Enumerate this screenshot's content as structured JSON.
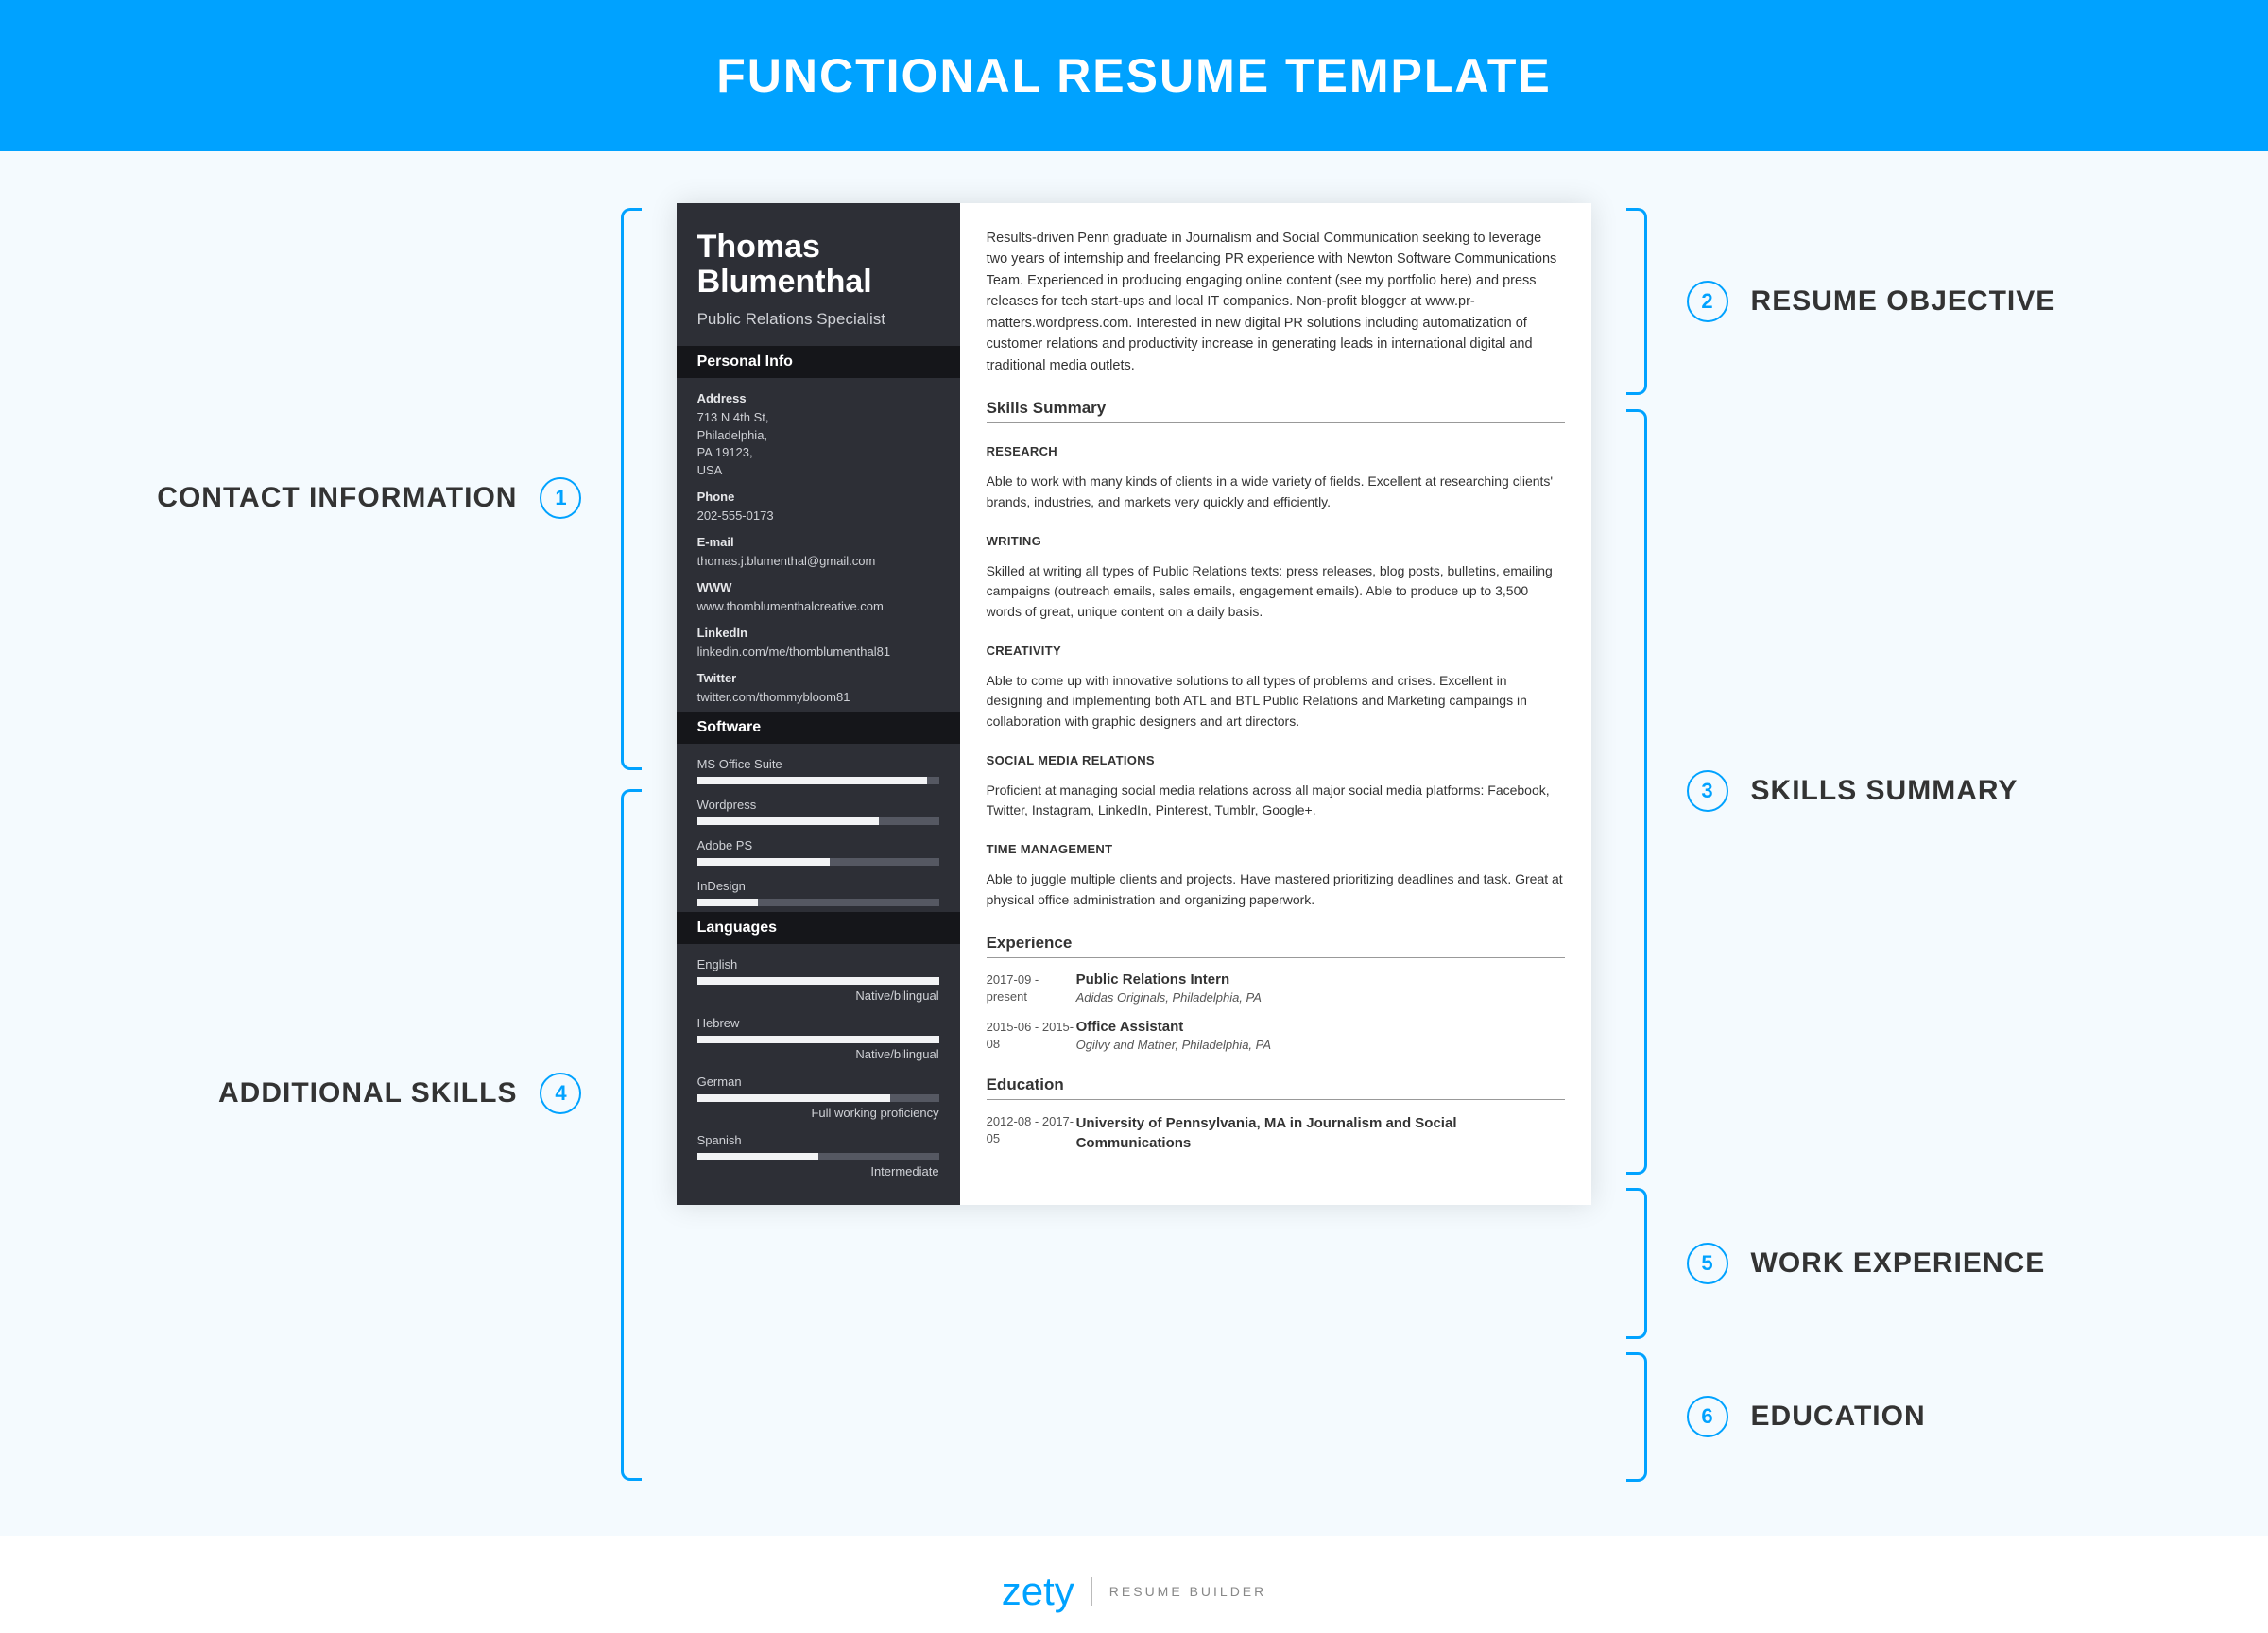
{
  "header": {
    "title": "FUNCTIONAL RESUME TEMPLATE"
  },
  "callouts": {
    "left": [
      {
        "num": "1",
        "text": "CONTACT INFORMATION"
      },
      {
        "num": "4",
        "text": "ADDITIONAL SKILLS"
      }
    ],
    "right": [
      {
        "num": "2",
        "text": "RESUME OBJECTIVE"
      },
      {
        "num": "3",
        "text": "SKILLS SUMMARY"
      },
      {
        "num": "5",
        "text": "WORK EXPERIENCE"
      },
      {
        "num": "6",
        "text": "EDUCATION"
      }
    ]
  },
  "resume": {
    "name_first": "Thomas",
    "name_last": "Blumenthal",
    "jobtitle": "Public Relations Specialist",
    "contact_header": "Personal Info",
    "contact": [
      {
        "label": "Address",
        "value": "713 N 4th St,\nPhiladelphia,\nPA 19123,\nUSA"
      },
      {
        "label": "Phone",
        "value": "202-555-0173"
      },
      {
        "label": "E-mail",
        "value": "thomas.j.blumenthal@gmail.com"
      },
      {
        "label": "WWW",
        "value": "www.thomblumenthalcreative.com"
      },
      {
        "label": "LinkedIn",
        "value": "linkedin.com/me/thomblumenthal81"
      },
      {
        "label": "Twitter",
        "value": "twitter.com/thommybloom81"
      }
    ],
    "software_header": "Software",
    "software": [
      {
        "name": "MS Office Suite",
        "pct": 95
      },
      {
        "name": "Wordpress",
        "pct": 75
      },
      {
        "name": "Adobe PS",
        "pct": 55
      },
      {
        "name": "InDesign",
        "pct": 25
      }
    ],
    "languages_header": "Languages",
    "languages": [
      {
        "name": "English",
        "pct": 100,
        "level": "Native/bilingual"
      },
      {
        "name": "Hebrew",
        "pct": 100,
        "level": "Native/bilingual"
      },
      {
        "name": "German",
        "pct": 80,
        "level": "Full working proficiency"
      },
      {
        "name": "Spanish",
        "pct": 50,
        "level": "Intermediate"
      }
    ],
    "objective": "Results-driven Penn graduate in Journalism and Social Communication seeking to leverage two years of internship and freelancing PR experience with Newton Software Communications Team. Experienced in producing engaging online content (see my portfolio here) and press releases for tech start-ups and local IT companies. Non-profit blogger at www.pr-matters.wordpress.com. Interested in new digital PR solutions including automatization of customer relations and productivity increase in generating leads in international digital and traditional media outlets.",
    "skills_summary_title": "Skills Summary",
    "skills": [
      {
        "title": "RESEARCH",
        "body": "Able to work with many kinds of clients in a wide variety of fields. Excellent at researching clients' brands, industries, and markets very quickly and efficiently."
      },
      {
        "title": "WRITING",
        "body": "Skilled at writing all types of Public Relations texts: press releases, blog posts, bulletins, emailing campaigns (outreach emails, sales emails, engagement emails). Able to produce up to 3,500 words of great, unique content on a daily basis."
      },
      {
        "title": "CREATIVITY",
        "body": "Able to come up with innovative solutions to all types of problems and crises. Excellent in designing and implementing both ATL and BTL Public Relations and Marketing campaings in collaboration with graphic designers and art directors."
      },
      {
        "title": "SOCIAL MEDIA RELATIONS",
        "body": "Proficient at managing social media relations across all major social media platforms: Facebook, Twitter, Instagram, LinkedIn, Pinterest, Tumblr, Google+."
      },
      {
        "title": "TIME MANAGEMENT",
        "body": "Able to juggle multiple clients and projects. Have mastered prioritizing deadlines and task. Great at physical office administration and organizing paperwork."
      }
    ],
    "experience_title": "Experience",
    "experience": [
      {
        "dates": "2017-09 - present",
        "title": "Public Relations Intern",
        "sub": "Adidas Originals, Philadelphia, PA"
      },
      {
        "dates": "2015-06 - 2015-08",
        "title": "Office Assistant",
        "sub": "Ogilvy and Mather, Philadelphia, PA"
      }
    ],
    "education_title": "Education",
    "education": [
      {
        "dates": "2012-08 - 2017-05",
        "title": "University of Pennsylvania, MA in Journalism and Social Communications"
      }
    ]
  },
  "footer": {
    "brand": "zety",
    "tag": "RESUME BUILDER"
  }
}
